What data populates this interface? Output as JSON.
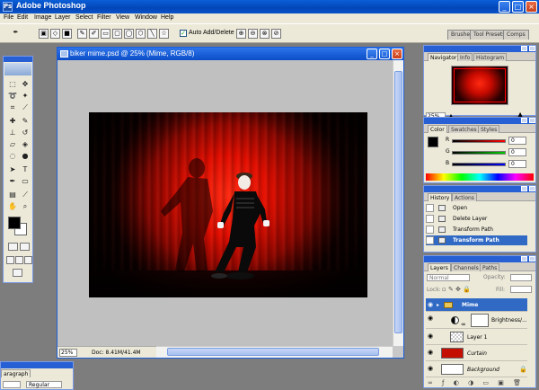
{
  "app": {
    "title": "Adobe Photoshop",
    "icon": "Ps"
  },
  "window_controls": {
    "minimize": "_",
    "maximize": "□",
    "close": "×"
  },
  "menu": [
    "File",
    "Edit",
    "Image",
    "Layer",
    "Select",
    "Filter",
    "View",
    "Window",
    "Help"
  ],
  "options_bar": {
    "auto_add_delete": "Auto Add/Delete",
    "checked": "✓"
  },
  "palette_well": {
    "tabs": [
      "Brushes",
      "Tool Presets",
      "Comps"
    ]
  },
  "document": {
    "title": "biker mime.psd @ 25% (Mime, RGB/8)",
    "zoom": "25%",
    "doc_size": "Doc: 8.41M/41.4M"
  },
  "navigator": {
    "tabs": [
      "Navigator",
      "Info",
      "Histogram"
    ],
    "zoom": "25%"
  },
  "color": {
    "tabs": [
      "Color",
      "Swatches",
      "Styles"
    ],
    "channels": [
      {
        "label": "R",
        "value": "0"
      },
      {
        "label": "G",
        "value": "0"
      },
      {
        "label": "B",
        "value": "0"
      }
    ]
  },
  "history": {
    "tabs": [
      "History",
      "Actions"
    ],
    "items": [
      "Open",
      "Delete Layer",
      "Transform Path",
      "Transform Path"
    ]
  },
  "layers": {
    "tabs": [
      "Layers",
      "Channels",
      "Paths"
    ],
    "blend_mode": "Normal",
    "opacity_label": "Opacity:",
    "lock_label": "Lock:",
    "fill_label": "Fill:",
    "items": [
      {
        "name": "Mime",
        "type": "group"
      },
      {
        "name": "Brightness/...",
        "type": "adjustment"
      },
      {
        "name": "Layer 1",
        "type": "layer"
      },
      {
        "name": "Curtain",
        "type": "layer"
      },
      {
        "name": "Background",
        "type": "background"
      }
    ]
  },
  "paragraph_panel": {
    "tab": "aragraph",
    "font_style": "Regular"
  }
}
